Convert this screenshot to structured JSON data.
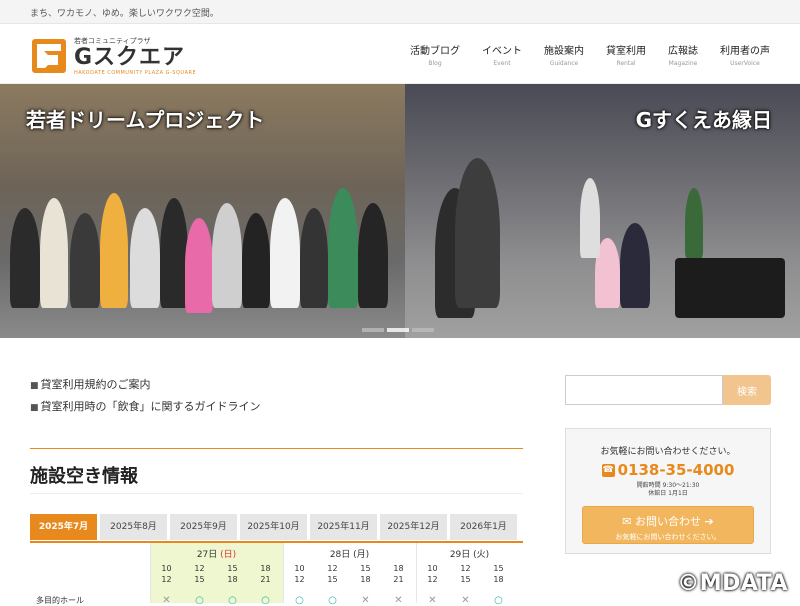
{
  "tagline": "まち、ワカモノ、ゆめ。楽しいワクワク空間。",
  "logo": {
    "small": "若者コミュニティプラザ",
    "name": "Gスクエア",
    "sub": "HAKODATE COMMUNITY PLAZA G-SQUARE"
  },
  "nav": [
    {
      "label": "活動ブログ",
      "en": "Blog"
    },
    {
      "label": "イベント",
      "en": "Event"
    },
    {
      "label": "施設案内",
      "en": "Guidance"
    },
    {
      "label": "貸室利用",
      "en": "Rental"
    },
    {
      "label": "広報誌",
      "en": "Magazine"
    },
    {
      "label": "利用者の声",
      "en": "UserVoice"
    }
  ],
  "hero": {
    "left_title": "若者ドリームプロジェクト",
    "right_title": "Gすくえあ縁日"
  },
  "links": [
    "貸室利用規約のご案内",
    "貸室利用時の「飲食」に関するガイドライン"
  ],
  "section_title": "施設空き情報",
  "months": [
    "2025年7月",
    "2025年8月",
    "2025年9月",
    "2025年10月",
    "2025年11月",
    "2025年12月",
    "2026年1月"
  ],
  "calendar": {
    "days": [
      {
        "date": "27日",
        "weekday": "(日)"
      },
      {
        "date": "28日",
        "weekday": "(月)"
      },
      {
        "date": "29日",
        "weekday": "(火)"
      }
    ],
    "slots_top": [
      "10",
      "12",
      "15",
      "18"
    ],
    "slots_bottom": [
      "12",
      "15",
      "18",
      "21"
    ],
    "room": "多目的ホール"
  },
  "search": {
    "placeholder": "",
    "button": "検索"
  },
  "contact": {
    "lead": "お気軽にお問い合わせください。",
    "tel": "0138-35-4000",
    "hours": "開館時間 9:30～21:30",
    "closed": "休館日 1月1日",
    "button": "お問い合わせ",
    "button_sub": "お気軽にお問い合わせください。"
  },
  "watermark": "©MDATA"
}
